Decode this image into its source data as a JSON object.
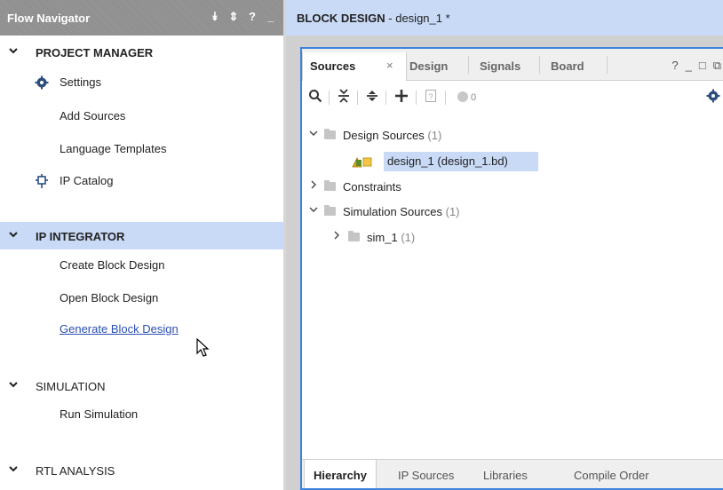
{
  "flow_navigator": {
    "title": "Flow Navigator",
    "tools": [
      "⯯",
      "⇕",
      "?",
      "_"
    ],
    "sections": {
      "project_manager": {
        "caret": "✔",
        "label": "PROJECT MANAGER",
        "items": {
          "settings": "Settings",
          "add_sources": "Add Sources",
          "language_templates": "Language Templates",
          "ip_catalog": "IP Catalog"
        }
      },
      "ip_integrator": {
        "label": "IP INTEGRATOR",
        "items": {
          "create_block_design": "Create Block Design",
          "open_block_design": "Open Block Design",
          "generate_block_design": "Generate Block Design"
        }
      },
      "simulation": {
        "label": "SIMULATION",
        "items": {
          "run_simulation": "Run Simulation"
        }
      },
      "rtl_analysis": {
        "label": "RTL ANALYSIS"
      }
    }
  },
  "block_design": {
    "title_bold": "BLOCK DESIGN",
    "title_rest": " - design_1 *"
  },
  "sources_window": {
    "tabs": {
      "sources": "Sources",
      "close": "×",
      "design": "Design",
      "signals": "Signals",
      "board": "Board"
    },
    "window_tools": [
      "?",
      "_",
      "□",
      "⧉"
    ],
    "toolbar": {
      "error_count": "0"
    },
    "tree": {
      "design_sources": {
        "label": "Design Sources",
        "count": "(1)"
      },
      "design_1": {
        "label": "design_1 (design_1.bd)"
      },
      "constraints": {
        "label": "Constraints"
      },
      "simulation_sources": {
        "label": "Simulation Sources",
        "count": "(1)"
      },
      "sim_1": {
        "label": "sim_1",
        "count": "(1)"
      }
    },
    "bottom_tabs": {
      "hierarchy": "Hierarchy",
      "ip_sources": "IP Sources",
      "libraries": "Libraries",
      "compile_order": "Compile Order"
    }
  },
  "colors": {
    "selection": "#c9daf6",
    "focus_border": "#3c82de",
    "link": "#2a4fb3"
  },
  "icons": [
    "gear-icon",
    "ip-catalog-icon",
    "search-icon",
    "collapse-all-icon",
    "expand-all-icon",
    "add-icon",
    "help-doc-icon",
    "status-dot-icon",
    "settings-gear-icon",
    "block-design-icon",
    "folder-icon",
    "mouse-cursor-icon"
  ]
}
